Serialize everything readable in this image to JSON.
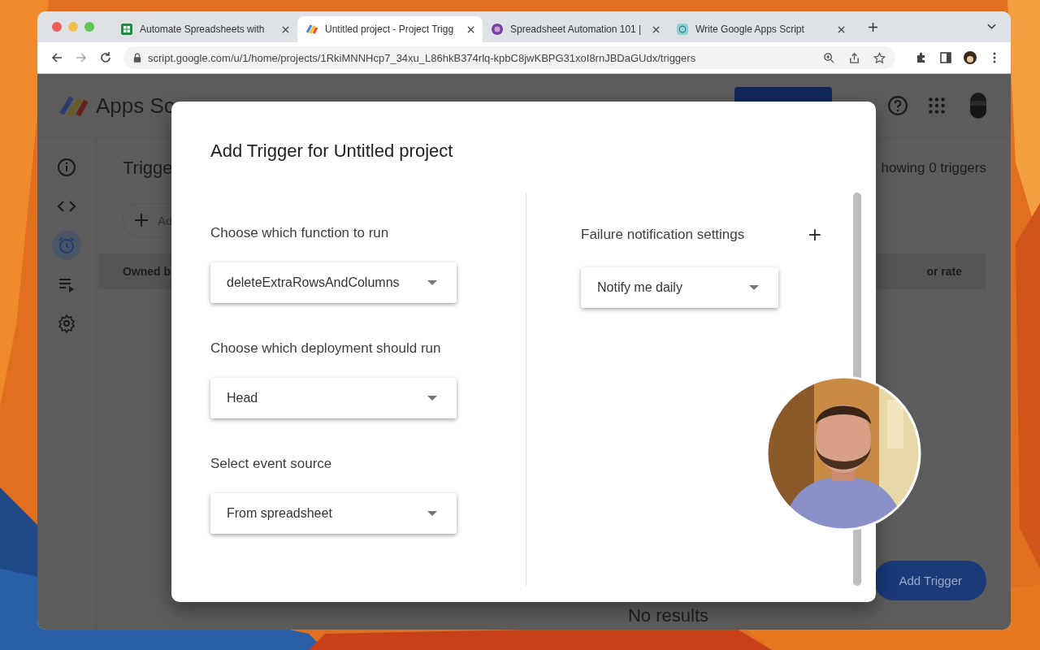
{
  "browser": {
    "tabs": [
      {
        "title": "Automate Spreadsheets with",
        "selected": false,
        "kind": "sheets"
      },
      {
        "title": "Untitled project - Project Trigg",
        "selected": true,
        "kind": "script"
      },
      {
        "title": "Spreadsheet Automation 101 |",
        "selected": false,
        "kind": "course"
      },
      {
        "title": "Write Google Apps Script",
        "selected": false,
        "kind": "doc"
      }
    ],
    "url": "script.google.com/u/1/home/projects/1RkiMNNHcp7_34xu_L86hkB374rlq-kpbC8jwKBPG31xoI8rnJBDaGUdx/triggers"
  },
  "page": {
    "app_title": "Apps Sc",
    "rail": [
      {
        "kind": "info",
        "selected": false
      },
      {
        "kind": "code",
        "selected": false
      },
      {
        "kind": "clock",
        "selected": true
      },
      {
        "kind": "list",
        "selected": false
      },
      {
        "kind": "gear",
        "selected": false
      }
    ],
    "section_title": "Trigge",
    "summary": "howing 0 triggers",
    "add_button": "Ad",
    "columns": [
      "Owned b",
      "or rate"
    ],
    "add_trigger_button": "Add Trigger",
    "empty_message": "No results"
  },
  "dialog": {
    "title": "Add Trigger for Untitled project",
    "fields": [
      {
        "label": "Choose which function to run",
        "value": "deleteExtraRowsAndColumns"
      },
      {
        "label": "Choose which deployment should run",
        "value": "Head"
      },
      {
        "label": "Select event source",
        "value": "From spreadsheet"
      }
    ],
    "failure": {
      "label": "Failure notification settings",
      "add": "+",
      "value": "Notify me daily"
    }
  }
}
